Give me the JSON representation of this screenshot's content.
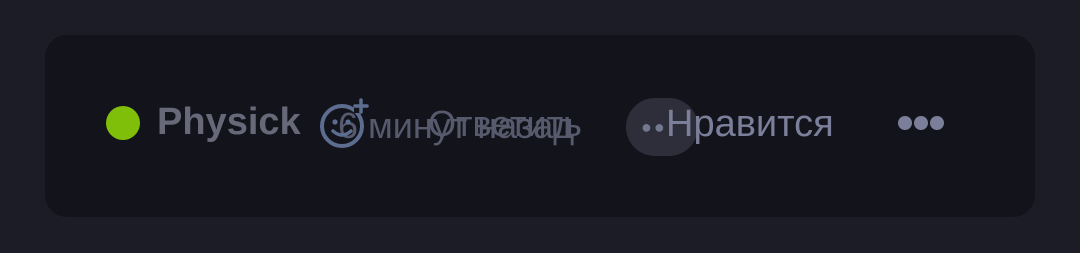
{
  "comment": {
    "status_color": "#7fbf0a",
    "username": "Physick",
    "timestamp": "6 минут назад",
    "reply_label": "Ответить",
    "like_label": "Нравится",
    "react_icon": "add-reaction-icon",
    "overflow_icon": "more-horizontal-icon",
    "bubble_icon": "more-dots-icon"
  }
}
